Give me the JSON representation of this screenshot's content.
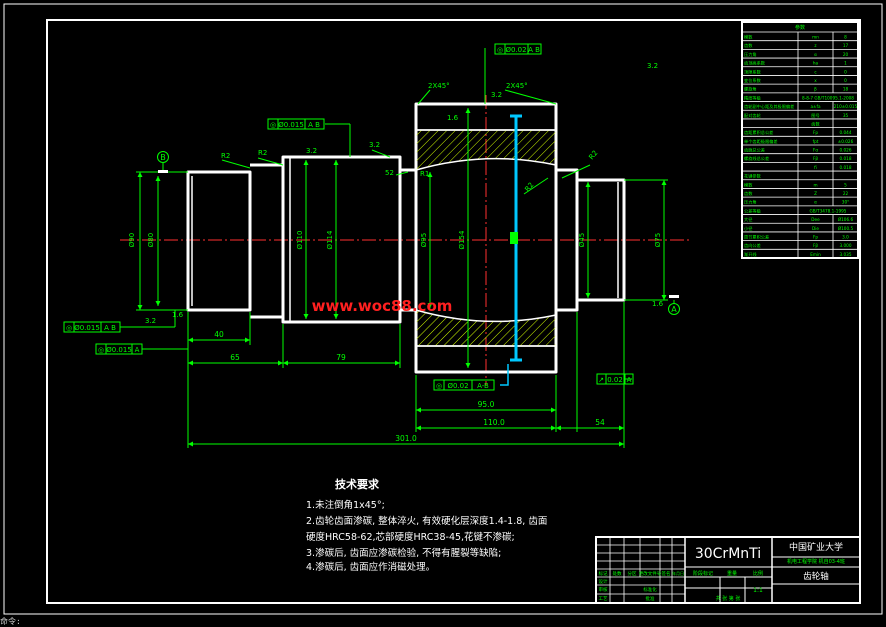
{
  "watermark": "www.woc88.com",
  "datum_b": "B",
  "datum_a": "A",
  "fcf": {
    "top_center": {
      "symbol": "◎",
      "value": "Ø0.02",
      "datum": "A B"
    },
    "left_upper": {
      "symbol": "◎",
      "value": "Ø0.015",
      "datum": "A B"
    },
    "left_mid": {
      "symbol": "◎",
      "value": "Ø0.015",
      "datum": "A B"
    },
    "left_low": {
      "symbol": "◎",
      "value": "Ø0.015",
      "datum": "A"
    },
    "gear_bottom": {
      "symbol": "◎",
      "value": "Ø0.02",
      "datum": "A-B"
    },
    "right_low": {
      "symbol": "↗",
      "value": "0.02",
      "datum": "A"
    }
  },
  "labels": {
    "chamfer_left": "2X45°",
    "chamfer_right": "2X45°",
    "r2_a": "R2",
    "r2_b": "R2",
    "r1": "R1",
    "r2_c": "R2",
    "r2_d": "R2",
    "ra_a": "3.2",
    "ra_b": "3.2",
    "ra_c": "3.2",
    "ra_d": "1.6",
    "ra_e": "3.2",
    "ra_f": "1.6",
    "ra_g": "1.6",
    "ra_corner": "3.2",
    "num_52": "52",
    "dia_left_1": "Ø90",
    "dia_left_2": "Ø80",
    "dia_110": "Ø110",
    "dia_114": "Ø114",
    "dia_95": "Ø95",
    "dia_154": "Ø154",
    "dia_right_1": "Ø45",
    "dia_right_2": "Ø75"
  },
  "dims": {
    "d40": "40",
    "d65": "65",
    "d79": "79",
    "d95": "95.0",
    "d110": "110.0",
    "d54": "54",
    "d301": "301.0"
  },
  "gear_table": {
    "title": "参数",
    "rows": [
      [
        "模数",
        "mn",
        "8"
      ],
      [
        "齿数",
        "z",
        "17"
      ],
      [
        "压力角",
        "α",
        "20"
      ],
      [
        "齿顶高系数",
        "ha",
        "1"
      ],
      [
        "顶隙系数",
        "c",
        "0"
      ],
      [
        "变位系数",
        "x",
        "0"
      ],
      [
        "螺旋角",
        "β",
        "18"
      ],
      [
        "精度等级",
        "",
        "8-8-7 GB/T10095.1-2008"
      ],
      [
        "齿轮副中心距及其极限偏差",
        "a±fa",
        "210±0.015"
      ],
      [
        "配对齿轮",
        "图号",
        "35"
      ],
      [
        "",
        "齿数",
        ""
      ],
      [
        "齿距累积总公差",
        "Fp",
        "0.044"
      ],
      [
        "单个齿距极限偏差",
        "fpt",
        "±0.026"
      ],
      [
        "齿廓总公差",
        "Fα",
        "0.026"
      ],
      [
        "螺旋线总公差",
        "Fβ",
        "0.018"
      ],
      [
        "",
        "fi",
        "0.018"
      ],
      [
        "花键参数",
        "",
        ""
      ],
      [
        "模数",
        "m",
        "5"
      ],
      [
        "齿数",
        "Z",
        "22"
      ],
      [
        "压力角",
        "α",
        "30°"
      ],
      [
        "公差等级",
        "",
        "GB/T3478.1-1995"
      ],
      [
        "大径",
        "Dee",
        "Ø106.6"
      ],
      [
        "小径",
        "Die",
        "Ø100.5"
      ],
      [
        "周节累积公差",
        "Fp",
        "3.0"
      ],
      [
        "齿向公差",
        "Fβ",
        "3.000"
      ],
      [
        "渐开线",
        "Emin",
        "3.035"
      ]
    ]
  },
  "tech_req": {
    "title": "技术要求",
    "lines": [
      "1.未注倒角1x45°;",
      "2.齿轮齿面渗碳, 整体淬火, 有效硬化层深度1.4-1.8, 齿面",
      "   硬度HRC58-62,芯部硬度HRC38-45,花键不渗碳;",
      "3.渗碳后, 齿面应渗碳检验, 不得有腥裂等缺陷;",
      "4.渗碳后, 齿面应作消磁处理。"
    ]
  },
  "title_block": {
    "material": "30CrMnTi",
    "university": "中国矿业大学",
    "class": "机电工程学院  机自03-4班",
    "part": "齿轮轴",
    "scale_label": "比例",
    "scale": "1:1",
    "left_headers": [
      "标记",
      "处数",
      "分区",
      "更改文件号",
      "签名",
      "年月日"
    ],
    "roles": [
      "设计",
      "审核",
      "工艺",
      "标准化",
      "批准"
    ],
    "stage_headers": [
      "阶段标记",
      "重量",
      "比例"
    ],
    "sheet": "共 张  第 张"
  },
  "command_line": "命令:"
}
